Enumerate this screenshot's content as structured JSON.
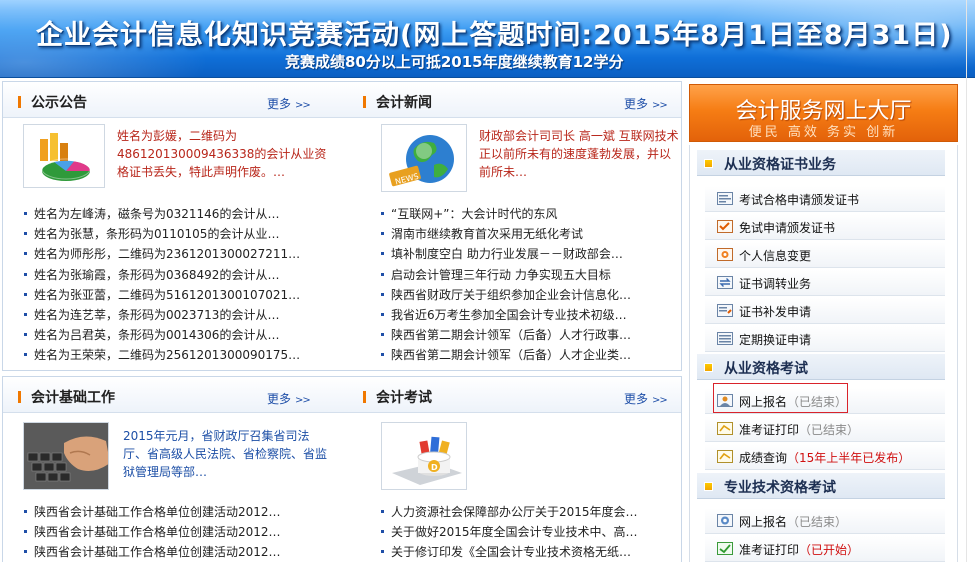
{
  "banner": {
    "title": "企业会计信息化知识竞赛活动(网上答题时间:2015年8月1日至8月31日)",
    "subtitle": "竞赛成绩80分以上可抵2015年度继续教育12学分"
  },
  "more_label": "更多",
  "more_arrow": ">>",
  "notice": {
    "title": "公示公告",
    "featured": "姓名为彭媛，二维码为486120130009436338的会计从业资格证书丢失，特此声明作废。…",
    "items": [
      "姓名为左峰涛，磁条号为0321146的会计从…",
      "姓名为张慧，条形码为0110105的会计从业…",
      "姓名为师彤彤，二维码为2361201300027211…",
      "姓名为张瑜霞，条形码为0368492的会计从…",
      "姓名为张亚蕾，二维码为5161201300107021…",
      "姓名为连艺莘，条形码为0023713的会计从…",
      "姓名为吕君英，条形码为0014306的会计从…",
      "姓名为王荣荣，二维码为2561201300090175…"
    ]
  },
  "news": {
    "title": "会计新闻",
    "featured": "财政部会计司司长 高一斌 互联网技术正以前所未有的速度蓬勃发展，并以前所未…",
    "items": [
      "“互联网+”：大会计时代的东风",
      "渭南市继续教育首次采用无纸化考试",
      "填补制度空白 助力行业发展－－财政部会…",
      "启动会计管理三年行动 力争实现五大目标",
      "陕西省财政厅关于组织参加企业会计信息化…",
      "我省近6万考生参加全国会计专业技术初级…",
      "陕西省第二期会计领军（后备）人才行政事…",
      "陕西省第二期会计领军（后备）人才企业类…"
    ]
  },
  "basics": {
    "title": "会计基础工作",
    "featured": "2015年元月，省财政厅召集省司法厅、省高级人民法院、省检察院、省监狱管理局等部…",
    "items": [
      "陕西省会计基础工作合格单位创建活动2012…",
      "陕西省会计基础工作合格单位创建活动2012…",
      "陕西省会计基础工作合格单位创建活动2012…"
    ]
  },
  "exam": {
    "title": "会计考试",
    "items": [
      "人力资源社会保障部办公厅关于2015年度会…",
      "关于做好2015年度全国会计专业技术中、高…",
      "关于修订印发《全国会计专业技术资格无纸…"
    ]
  },
  "hall": {
    "title": "会计服务网上大厅",
    "subtitle": "便民 高效 务实 创新"
  },
  "sections": [
    {
      "title": "从业资格证书业务",
      "items": [
        {
          "label": "考试合格申请颁发证书",
          "status": "",
          "icon": "form-icon"
        },
        {
          "label": "免试申请颁发证书",
          "status": "",
          "icon": "exempt-icon"
        },
        {
          "label": "个人信息变更",
          "status": "",
          "icon": "edit-icon"
        },
        {
          "label": "证书调转业务",
          "status": "",
          "icon": "transfer-icon"
        },
        {
          "label": "证书补发申请",
          "status": "",
          "icon": "reissue-icon"
        },
        {
          "label": "定期换证申请",
          "status": "",
          "icon": "renew-icon"
        }
      ]
    },
    {
      "title": "从业资格考试",
      "items": [
        {
          "label": "网上报名",
          "status": "（已结束）",
          "icon": "signup-icon"
        },
        {
          "label": "准考证打印",
          "status": "（已结束）",
          "icon": "print-icon"
        },
        {
          "label": "成绩查询",
          "status": "（15年上半年已发布）",
          "icon": "score-icon"
        }
      ]
    },
    {
      "title": "专业技术资格考试",
      "items": [
        {
          "label": "网上报名",
          "status": "（已结束）",
          "icon": "signup-icon"
        },
        {
          "label": "准考证打印",
          "status": "（已开始）",
          "icon": "print-icon"
        }
      ]
    }
  ],
  "colors": {
    "accent_orange": "#f07800",
    "link_blue": "#1f4fa8",
    "featured_red": "#b8261a",
    "status_red": "#d01010",
    "status_gray": "#8a8a8a"
  }
}
